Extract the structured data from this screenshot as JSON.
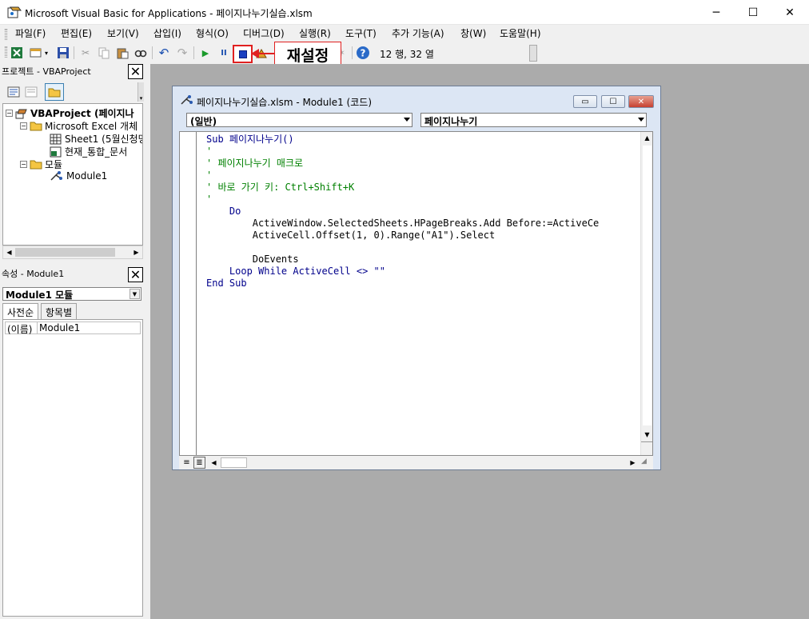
{
  "window": {
    "title": "Microsoft Visual Basic for Applications - 페이지나누기실습.xlsm",
    "minimize": "─",
    "maximize": "☐",
    "close": "✕"
  },
  "menu": [
    "파일(F)",
    "편집(E)",
    "보기(V)",
    "삽입(I)",
    "형식(O)",
    "디버그(D)",
    "실행(R)",
    "도구(T)",
    "추가 기능(A)",
    "창(W)",
    "도움말(H)"
  ],
  "toolbar": {
    "position": "12 행, 32 열"
  },
  "callout": {
    "label": "재설정"
  },
  "project_pane": {
    "title": "프로젝트 - VBAProject",
    "root": "VBAProject (페이지나",
    "folder_excel": "Microsoft Excel 개체",
    "sheet1": "Sheet1 (5월신청명",
    "workbook": "현재_통합_문서",
    "folder_modules": "모듈",
    "module1": "Module1"
  },
  "props_pane": {
    "title": "속성 - Module1",
    "object": "Module1 모듈",
    "tab_alpha": "사전순",
    "tab_cat": "항목별",
    "prop_name": "(이름)",
    "prop_value": "Module1"
  },
  "code_window": {
    "title": "페이지나누기실습.xlsm - Module1 (코드)",
    "object_combo": "(일반)",
    "proc_combo": "페이지나누기",
    "lines": [
      {
        "t": "Sub 페이지나누기()",
        "kind": "sub"
      },
      {
        "t": "'",
        "kind": "comment"
      },
      {
        "t": "' 페이지나누기 매크로",
        "kind": "comment"
      },
      {
        "t": "'",
        "kind": "comment"
      },
      {
        "t": "' 바로 가기 키: Ctrl+Shift+K",
        "kind": "comment"
      },
      {
        "t": "'",
        "kind": "comment"
      },
      {
        "t": "    Do",
        "kind": "kw"
      },
      {
        "t": "        ActiveWindow.SelectedSheets.HPageBreaks.Add Before:=ActiveCe",
        "kind": "plain"
      },
      {
        "t": "        ActiveCell.Offset(1, 0).Range(\"A1\").Select",
        "kind": "plain"
      },
      {
        "t": "",
        "kind": "plain"
      },
      {
        "t": "        DoEvents",
        "kind": "plain"
      },
      {
        "t": "    Loop While ActiveCell <> \"\"",
        "kind": "loop"
      },
      {
        "t": "End Sub",
        "kind": "kw"
      }
    ]
  }
}
